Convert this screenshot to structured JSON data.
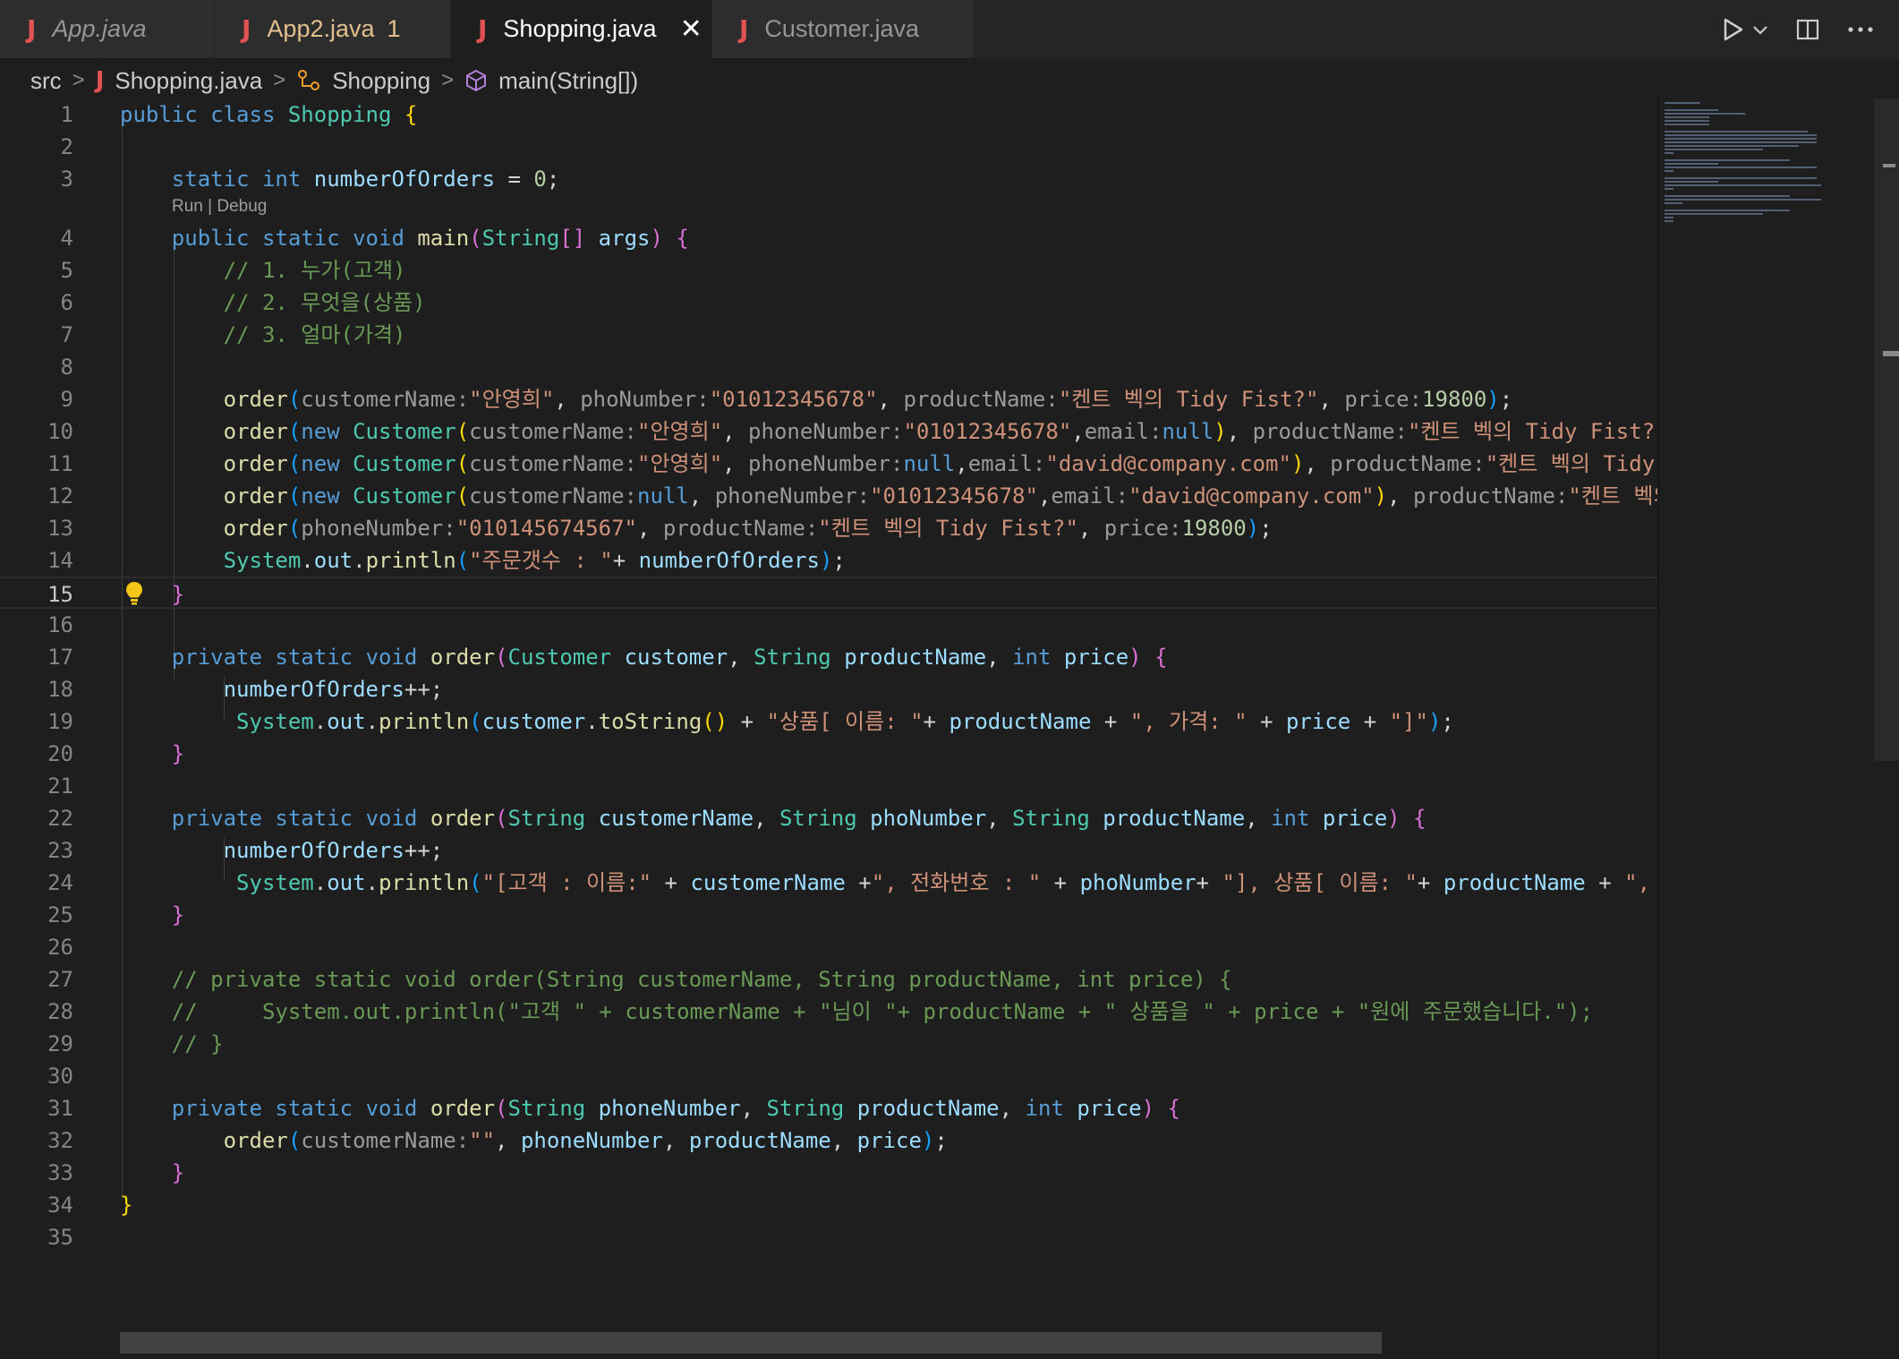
{
  "tabs": [
    {
      "label": "App.java",
      "style": "preview"
    },
    {
      "label": "App2.java",
      "badge": "1",
      "style": "modified"
    },
    {
      "label": "Shopping.java",
      "style": "active"
    },
    {
      "label": "Customer.java",
      "style": "normal"
    }
  ],
  "breadcrumb": {
    "folder": "src",
    "file": "Shopping.java",
    "class": "Shopping",
    "method": "main(String[])"
  },
  "codelens": "Run | Debug",
  "editor": {
    "current_line": 15,
    "line_numbers": [
      "1",
      "2",
      "3",
      "4",
      "5",
      "6",
      "7",
      "8",
      "9",
      "10",
      "11",
      "12",
      "13",
      "14",
      "15",
      "16",
      "17",
      "18",
      "19",
      "20",
      "21",
      "22",
      "23",
      "24",
      "25",
      "26",
      "27",
      "28",
      "29",
      "30",
      "31",
      "32",
      "33",
      "34",
      "35"
    ],
    "lines": [
      [
        [
          "k",
          "public"
        ],
        [
          "p",
          " "
        ],
        [
          "k",
          "class"
        ],
        [
          "p",
          " "
        ],
        [
          "cl",
          "Shopping"
        ],
        [
          "p",
          " "
        ],
        [
          "b1",
          "{"
        ]
      ],
      [],
      [
        [
          "p",
          "    "
        ],
        [
          "k",
          "static"
        ],
        [
          "p",
          " "
        ],
        [
          "k",
          "int"
        ],
        [
          "p",
          " "
        ],
        [
          "v",
          "numberOfOrders"
        ],
        [
          "p",
          " = "
        ],
        [
          "n",
          "0"
        ],
        [
          "p",
          ";"
        ]
      ],
      [
        [
          "p",
          "    "
        ],
        [
          "k",
          "public"
        ],
        [
          "p",
          " "
        ],
        [
          "k",
          "static"
        ],
        [
          "p",
          " "
        ],
        [
          "k",
          "void"
        ],
        [
          "p",
          " "
        ],
        [
          "f",
          "main"
        ],
        [
          "b2",
          "("
        ],
        [
          "t",
          "String"
        ],
        [
          "b2",
          "[]"
        ],
        [
          "p",
          " "
        ],
        [
          "v",
          "args"
        ],
        [
          "b2",
          ")"
        ],
        [
          "p",
          " "
        ],
        [
          "b2",
          "{"
        ]
      ],
      [
        [
          "c",
          "        // 1. 누가(고객)"
        ]
      ],
      [
        [
          "c",
          "        // 2. 무엇을(상품)"
        ]
      ],
      [
        [
          "c",
          "        // 3. 얼마(가격)"
        ]
      ],
      [],
      [
        [
          "p",
          "        "
        ],
        [
          "f",
          "order"
        ],
        [
          "b3",
          "("
        ],
        [
          "h",
          "customerName:"
        ],
        [
          "s",
          "\"안영희\""
        ],
        [
          "p",
          ", "
        ],
        [
          "h",
          "phoNumber:"
        ],
        [
          "s",
          "\"01012345678\""
        ],
        [
          "p",
          ", "
        ],
        [
          "h",
          "productName:"
        ],
        [
          "s",
          "\"켄트 벡의 Tidy Fist?\""
        ],
        [
          "p",
          ", "
        ],
        [
          "h",
          "price:"
        ],
        [
          "n",
          "19800"
        ],
        [
          "b3",
          ")"
        ],
        [
          "p",
          ";"
        ]
      ],
      [
        [
          "p",
          "        "
        ],
        [
          "f",
          "order"
        ],
        [
          "b3",
          "("
        ],
        [
          "k",
          "new"
        ],
        [
          "p",
          " "
        ],
        [
          "t",
          "Customer"
        ],
        [
          "b1",
          "("
        ],
        [
          "h",
          "customerName:"
        ],
        [
          "s",
          "\"안영희\""
        ],
        [
          "p",
          ", "
        ],
        [
          "h",
          "phoneNumber:"
        ],
        [
          "s",
          "\"01012345678\""
        ],
        [
          "p",
          ","
        ],
        [
          "h",
          "email:"
        ],
        [
          "k",
          "null"
        ],
        [
          "b1",
          ")"
        ],
        [
          "p",
          ", "
        ],
        [
          "h",
          "productName:"
        ],
        [
          "s",
          "\"켄트 벡의 Tidy Fist?\""
        ]
      ],
      [
        [
          "p",
          "        "
        ],
        [
          "f",
          "order"
        ],
        [
          "b3",
          "("
        ],
        [
          "k",
          "new"
        ],
        [
          "p",
          " "
        ],
        [
          "t",
          "Customer"
        ],
        [
          "b1",
          "("
        ],
        [
          "h",
          "customerName:"
        ],
        [
          "s",
          "\"안영희\""
        ],
        [
          "p",
          ", "
        ],
        [
          "h",
          "phoneNumber:"
        ],
        [
          "k",
          "null"
        ],
        [
          "p",
          ","
        ],
        [
          "h",
          "email:"
        ],
        [
          "s",
          "\"david@company.com\""
        ],
        [
          "b1",
          ")"
        ],
        [
          "p",
          ", "
        ],
        [
          "h",
          "productName:"
        ],
        [
          "s",
          "\"켄트 벡의 Tidy"
        ]
      ],
      [
        [
          "p",
          "        "
        ],
        [
          "f",
          "order"
        ],
        [
          "b3",
          "("
        ],
        [
          "k",
          "new"
        ],
        [
          "p",
          " "
        ],
        [
          "t",
          "Customer"
        ],
        [
          "b1",
          "("
        ],
        [
          "h",
          "customerName:"
        ],
        [
          "k",
          "null"
        ],
        [
          "p",
          ", "
        ],
        [
          "h",
          "phoneNumber:"
        ],
        [
          "s",
          "\"01012345678\""
        ],
        [
          "p",
          ","
        ],
        [
          "h",
          "email:"
        ],
        [
          "s",
          "\"david@company.com\""
        ],
        [
          "b1",
          ")"
        ],
        [
          "p",
          ", "
        ],
        [
          "h",
          "productName:"
        ],
        [
          "s",
          "\"켄트 벡의"
        ]
      ],
      [
        [
          "p",
          "        "
        ],
        [
          "f",
          "order"
        ],
        [
          "b3",
          "("
        ],
        [
          "h",
          "phoneNumber:"
        ],
        [
          "s",
          "\"010145674567\""
        ],
        [
          "p",
          ", "
        ],
        [
          "h",
          "productName:"
        ],
        [
          "s",
          "\"켄트 벡의 Tidy Fist?\""
        ],
        [
          "p",
          ", "
        ],
        [
          "h",
          "price:"
        ],
        [
          "n",
          "19800"
        ],
        [
          "b3",
          ")"
        ],
        [
          "p",
          ";"
        ]
      ],
      [
        [
          "p",
          "        "
        ],
        [
          "t",
          "System"
        ],
        [
          "p",
          "."
        ],
        [
          "v",
          "out"
        ],
        [
          "p",
          "."
        ],
        [
          "f",
          "println"
        ],
        [
          "b3",
          "("
        ],
        [
          "s",
          "\"주문갯수 : \""
        ],
        [
          "p",
          "+ "
        ],
        [
          "v",
          "numberOfOrders"
        ],
        [
          "b3",
          ")"
        ],
        [
          "p",
          ";"
        ]
      ],
      [
        [
          "p",
          "    "
        ],
        [
          "b2",
          "}"
        ]
      ],
      [],
      [
        [
          "p",
          "    "
        ],
        [
          "k",
          "private"
        ],
        [
          "p",
          " "
        ],
        [
          "k",
          "static"
        ],
        [
          "p",
          " "
        ],
        [
          "k",
          "void"
        ],
        [
          "p",
          " "
        ],
        [
          "f",
          "order"
        ],
        [
          "b2",
          "("
        ],
        [
          "t",
          "Customer"
        ],
        [
          "p",
          " "
        ],
        [
          "v",
          "customer"
        ],
        [
          "p",
          ", "
        ],
        [
          "t",
          "String"
        ],
        [
          "p",
          " "
        ],
        [
          "v",
          "productName"
        ],
        [
          "p",
          ", "
        ],
        [
          "k",
          "int"
        ],
        [
          "p",
          " "
        ],
        [
          "v",
          "price"
        ],
        [
          "b2",
          ")"
        ],
        [
          "p",
          " "
        ],
        [
          "b2",
          "{"
        ]
      ],
      [
        [
          "p",
          "        "
        ],
        [
          "v",
          "numberOfOrders"
        ],
        [
          "p",
          "++;"
        ]
      ],
      [
        [
          "p",
          "         "
        ],
        [
          "t",
          "System"
        ],
        [
          "p",
          "."
        ],
        [
          "v",
          "out"
        ],
        [
          "p",
          "."
        ],
        [
          "f",
          "println"
        ],
        [
          "b3",
          "("
        ],
        [
          "v",
          "customer"
        ],
        [
          "p",
          "."
        ],
        [
          "f",
          "toString"
        ],
        [
          "b1",
          "()"
        ],
        [
          "p",
          " + "
        ],
        [
          "s",
          "\"상품[ 이름: \""
        ],
        [
          "p",
          "+ "
        ],
        [
          "v",
          "productName"
        ],
        [
          "p",
          " + "
        ],
        [
          "s",
          "\", 가격: \""
        ],
        [
          "p",
          " + "
        ],
        [
          "v",
          "price"
        ],
        [
          "p",
          " + "
        ],
        [
          "s",
          "\"]\""
        ],
        [
          "b3",
          ")"
        ],
        [
          "p",
          ";"
        ]
      ],
      [
        [
          "p",
          "    "
        ],
        [
          "b2",
          "}"
        ]
      ],
      [],
      [
        [
          "p",
          "    "
        ],
        [
          "k",
          "private"
        ],
        [
          "p",
          " "
        ],
        [
          "k",
          "static"
        ],
        [
          "p",
          " "
        ],
        [
          "k",
          "void"
        ],
        [
          "p",
          " "
        ],
        [
          "f",
          "order"
        ],
        [
          "b2",
          "("
        ],
        [
          "t",
          "String"
        ],
        [
          "p",
          " "
        ],
        [
          "v",
          "customerName"
        ],
        [
          "p",
          ", "
        ],
        [
          "t",
          "String"
        ],
        [
          "p",
          " "
        ],
        [
          "v",
          "phoNumber"
        ],
        [
          "p",
          ", "
        ],
        [
          "t",
          "String"
        ],
        [
          "p",
          " "
        ],
        [
          "v",
          "productName"
        ],
        [
          "p",
          ", "
        ],
        [
          "k",
          "int"
        ],
        [
          "p",
          " "
        ],
        [
          "v",
          "price"
        ],
        [
          "b2",
          ")"
        ],
        [
          "p",
          " "
        ],
        [
          "b2",
          "{"
        ]
      ],
      [
        [
          "p",
          "        "
        ],
        [
          "v",
          "numberOfOrders"
        ],
        [
          "p",
          "++;"
        ]
      ],
      [
        [
          "p",
          "         "
        ],
        [
          "t",
          "System"
        ],
        [
          "p",
          "."
        ],
        [
          "v",
          "out"
        ],
        [
          "p",
          "."
        ],
        [
          "f",
          "println"
        ],
        [
          "b3",
          "("
        ],
        [
          "s",
          "\"[고객 : 이름:\""
        ],
        [
          "p",
          " + "
        ],
        [
          "v",
          "customerName"
        ],
        [
          "p",
          " +"
        ],
        [
          "s",
          "\", 전화번호 : \""
        ],
        [
          "p",
          " + "
        ],
        [
          "v",
          "phoNumber"
        ],
        [
          "p",
          "+ "
        ],
        [
          "s",
          "\"], 상품[ 이름: \""
        ],
        [
          "p",
          "+ "
        ],
        [
          "v",
          "productName"
        ],
        [
          "p",
          " + "
        ],
        [
          "s",
          "\", 가"
        ]
      ],
      [
        [
          "p",
          "    "
        ],
        [
          "b2",
          "}"
        ]
      ],
      [],
      [
        [
          "c",
          "    // private static void order(String customerName, String productName, int price) {"
        ]
      ],
      [
        [
          "c",
          "    //     System.out.println(\"고객 \" + customerName + \"님이 \"+ productName + \" 상품을 \" + price + \"원에 주문했습니다.\");"
        ]
      ],
      [
        [
          "c",
          "    // }"
        ]
      ],
      [],
      [
        [
          "p",
          "    "
        ],
        [
          "k",
          "private"
        ],
        [
          "p",
          " "
        ],
        [
          "k",
          "static"
        ],
        [
          "p",
          " "
        ],
        [
          "k",
          "void"
        ],
        [
          "p",
          " "
        ],
        [
          "f",
          "order"
        ],
        [
          "b2",
          "("
        ],
        [
          "t",
          "String"
        ],
        [
          "p",
          " "
        ],
        [
          "v",
          "phoneNumber"
        ],
        [
          "p",
          ", "
        ],
        [
          "t",
          "String"
        ],
        [
          "p",
          " "
        ],
        [
          "v",
          "productName"
        ],
        [
          "p",
          ", "
        ],
        [
          "k",
          "int"
        ],
        [
          "p",
          " "
        ],
        [
          "v",
          "price"
        ],
        [
          "b2",
          ")"
        ],
        [
          "p",
          " "
        ],
        [
          "b2",
          "{"
        ]
      ],
      [
        [
          "p",
          "        "
        ],
        [
          "f",
          "order"
        ],
        [
          "b3",
          "("
        ],
        [
          "h",
          "customerName:"
        ],
        [
          "s",
          "\"\""
        ],
        [
          "p",
          ", "
        ],
        [
          "v",
          "phoneNumber"
        ],
        [
          "p",
          ", "
        ],
        [
          "v",
          "productName"
        ],
        [
          "p",
          ", "
        ],
        [
          "v",
          "price"
        ],
        [
          "b3",
          ")"
        ],
        [
          "p",
          ";"
        ]
      ],
      [
        [
          "p",
          "    "
        ],
        [
          "b2",
          "}"
        ]
      ],
      [
        [
          "b1",
          "}"
        ]
      ],
      []
    ]
  },
  "icons": {
    "run": "play-icon",
    "run_menu": "chevron-down-icon",
    "split": "split-editor-icon",
    "more": "more-actions-icon",
    "lightbulb": "lightbulb-icon"
  }
}
